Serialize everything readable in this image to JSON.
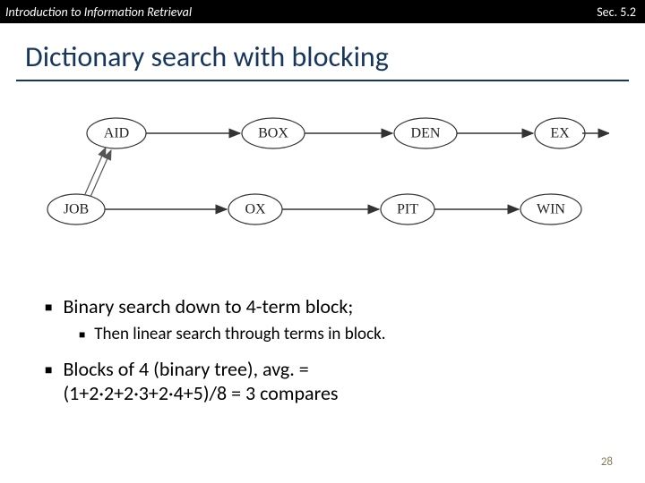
{
  "header": {
    "left": "Introduction to Information Retrieval",
    "right": "Sec. 5.2"
  },
  "title": "Dictionary search with blocking",
  "diagram": {
    "top_nodes": [
      "AID",
      "BOX",
      "DEN",
      "EX"
    ],
    "bottom_nodes": [
      "JOB",
      "OX",
      "PIT",
      "WIN"
    ]
  },
  "bullets": {
    "b1a": "Binary search down to 4-term block;",
    "b2a": "Then linear search through terms in block.",
    "b1b_line1": "Blocks of 4 (binary tree), avg. =",
    "b1b_line2": "(1+2·2+2·3+2·4+5)/8 = 3 compares"
  },
  "page_number": "28"
}
